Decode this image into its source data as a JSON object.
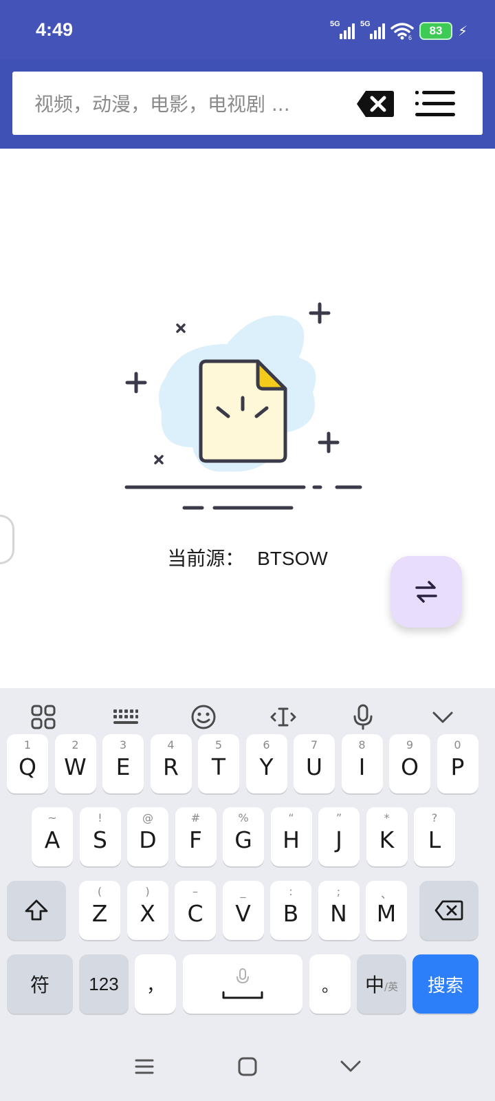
{
  "status_bar": {
    "time": "4:49",
    "signal_1_label": "5G",
    "signal_2_label": "5G",
    "wifi_badge": "6",
    "battery": "83"
  },
  "search": {
    "placeholder": "视频，动漫，电影，电视剧 ...",
    "value": ""
  },
  "empty_state": {
    "source_label": "当前源：",
    "source_value": "BTSOW"
  },
  "keyboard": {
    "row1": [
      {
        "key": "Q",
        "hint": "1"
      },
      {
        "key": "W",
        "hint": "2"
      },
      {
        "key": "E",
        "hint": "3"
      },
      {
        "key": "R",
        "hint": "4"
      },
      {
        "key": "T",
        "hint": "5"
      },
      {
        "key": "Y",
        "hint": "6"
      },
      {
        "key": "U",
        "hint": "7"
      },
      {
        "key": "I",
        "hint": "8"
      },
      {
        "key": "O",
        "hint": "9"
      },
      {
        "key": "P",
        "hint": "0"
      }
    ],
    "row2": [
      {
        "key": "A",
        "hint": "~"
      },
      {
        "key": "S",
        "hint": "!"
      },
      {
        "key": "D",
        "hint": "@"
      },
      {
        "key": "F",
        "hint": "#"
      },
      {
        "key": "G",
        "hint": "%"
      },
      {
        "key": "H",
        "hint": "“"
      },
      {
        "key": "J",
        "hint": "”"
      },
      {
        "key": "K",
        "hint": "*"
      },
      {
        "key": "L",
        "hint": "?"
      }
    ],
    "row3": [
      {
        "key": "Z",
        "hint": "("
      },
      {
        "key": "X",
        "hint": ")"
      },
      {
        "key": "C",
        "hint": "–"
      },
      {
        "key": "V",
        "hint": "_"
      },
      {
        "key": "B",
        "hint": ":"
      },
      {
        "key": "N",
        "hint": ";"
      },
      {
        "key": "M",
        "hint": "、"
      }
    ],
    "symbols_key": "符",
    "numbers_key": "123",
    "comma_key": "，",
    "period_key": "。",
    "lang_key_main": "中",
    "lang_key_sub": "/英",
    "search_key": "搜索"
  },
  "colors": {
    "appbar": "#3f51b5",
    "fab": "#e8ddfa",
    "search_key": "#2d7ff9"
  }
}
